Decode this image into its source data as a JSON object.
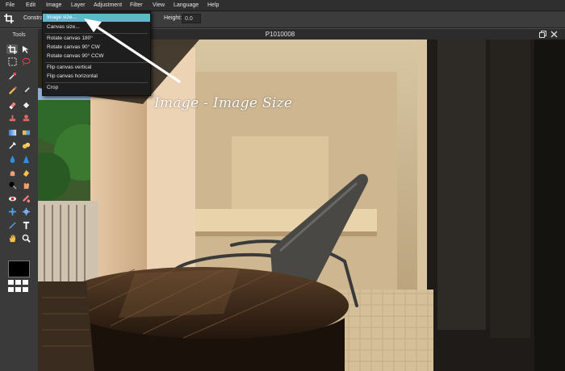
{
  "menubar": {
    "items": [
      "File",
      "Edit",
      "Image",
      "Layer",
      "Adjustment",
      "Filter",
      "View",
      "Language",
      "Help"
    ]
  },
  "options_bar": {
    "constrain_label": "Constrai",
    "height_label": "Height:",
    "height_value": "0.0"
  },
  "tools_panel": {
    "title": "Tools",
    "foreground_color": "#000000"
  },
  "document": {
    "title": "P1010008"
  },
  "image_menu": {
    "items": [
      {
        "label": "Image size...",
        "active": true
      },
      {
        "label": "Canvas size...",
        "active": false
      },
      {
        "label": "Rotate canvas 180°",
        "active": false
      },
      {
        "label": "Rotate canvas 90° CW",
        "active": false
      },
      {
        "label": "Rotate canvas 90° CCW",
        "active": false
      },
      {
        "label": "Flip canvas vertical",
        "active": false
      },
      {
        "label": "Flip canvas horizontal",
        "active": false
      },
      {
        "label": "Crop",
        "active": false
      }
    ]
  },
  "annotation": {
    "text": "Image - Image Size"
  },
  "colors": {
    "accent": "#5fb8c8",
    "menubar_bg": "#2f2f2f",
    "panel_bg": "#3a3a3a"
  }
}
